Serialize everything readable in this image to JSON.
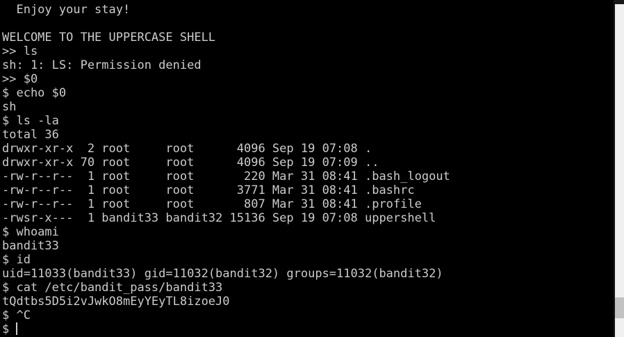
{
  "terminal": {
    "lines": [
      "  Enjoy your stay!",
      "",
      "WELCOME TO THE UPPERCASE SHELL",
      ">> ls",
      "sh: 1: LS: Permission denied",
      ">> $0",
      "$ echo $0",
      "sh",
      "$ ls -la",
      "total 36",
      "drwxr-xr-x  2 root     root      4096 Sep 19 07:08 .",
      "drwxr-xr-x 70 root     root      4096 Sep 19 07:09 ..",
      "-rw-r--r--  1 root     root       220 Mar 31 08:41 .bash_logout",
      "-rw-r--r--  1 root     root      3771 Mar 31 08:41 .bashrc",
      "-rw-r--r--  1 root     root       807 Mar 31 08:41 .profile",
      "-rwsr-x---  1 bandit33 bandit32 15136 Sep 19 07:08 uppershell",
      "$ whoami",
      "bandit33",
      "$ id",
      "uid=11033(bandit33) gid=11032(bandit32) groups=11032(bandit32)",
      "$ cat /etc/bandit_pass/bandit33",
      "tQdtbs5D5i2vJwkO8mEyYEyTL8izoeJ0",
      "$ ^C"
    ],
    "prompt": "$ "
  },
  "colors": {
    "background": "#000000",
    "text": "#cccccc",
    "scrollbar_track": "#f0f0f0",
    "scrollbar_thumb": "#c2c2c2"
  }
}
